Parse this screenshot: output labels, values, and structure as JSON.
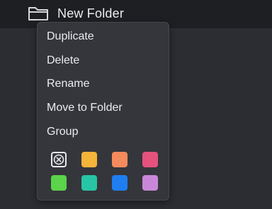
{
  "folder": {
    "name": "New Folder",
    "icon": "folder-icon"
  },
  "context_menu": {
    "items": [
      {
        "label": "Duplicate"
      },
      {
        "label": "Delete"
      },
      {
        "label": "Rename"
      },
      {
        "label": "Move to Folder"
      },
      {
        "label": "Group"
      }
    ],
    "colors": {
      "clear_icon": "circle-x-icon",
      "swatches": [
        {
          "name": "orange",
          "hex": "#f5b43a"
        },
        {
          "name": "coral",
          "hex": "#f58a5c"
        },
        {
          "name": "pink",
          "hex": "#e5527e"
        },
        {
          "name": "green",
          "hex": "#5bd34a"
        },
        {
          "name": "teal",
          "hex": "#27c4a6"
        },
        {
          "name": "blue",
          "hex": "#1f7ef0"
        },
        {
          "name": "purple",
          "hex": "#c987d8"
        }
      ]
    }
  }
}
